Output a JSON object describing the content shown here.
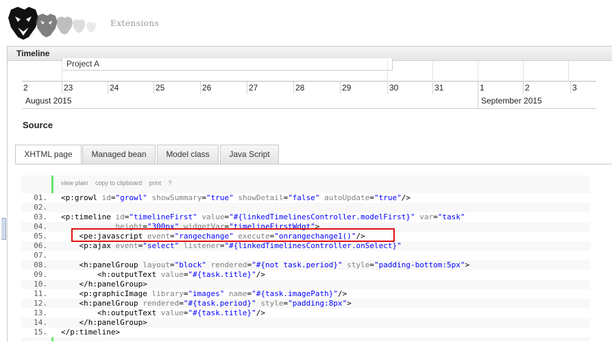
{
  "header": {
    "extensions_label": "Extensions"
  },
  "panel": {
    "title": "Timeline"
  },
  "timeline": {
    "event_label": "Project A",
    "days": [
      "2",
      "23",
      "24",
      "25",
      "26",
      "27",
      "28",
      "29",
      "30",
      "31",
      "1",
      "2",
      "3"
    ],
    "months": [
      "August 2015",
      "September 2015"
    ]
  },
  "source": {
    "title": "Source",
    "tabs": [
      "XHTML page",
      "Managed bean",
      "Model class",
      "Java Script"
    ]
  },
  "code": {
    "toolbar": [
      "view plain",
      "copy to clipboard",
      "print",
      "?"
    ],
    "lines": [
      {
        "n": "01.",
        "text": "<p:growl id=\"growl\" showSummary=\"true\" showDetail=\"false\" autoUpdate=\"true\"/>"
      },
      {
        "n": "02.",
        "text": ""
      },
      {
        "n": "03.",
        "text": "<p:timeline id=\"timelineFirst\" value=\"#{linkedTimelinesController.modelFirst}\" var=\"task\""
      },
      {
        "n": "04.",
        "text": "            height=\"300px\" widgetVar=\"timelineFirstWdgt\">"
      },
      {
        "n": "05.",
        "text": "    <pe:javascript event=\"rangechange\" execute=\"onrangechange1()\"/>"
      },
      {
        "n": "06.",
        "text": "    <p:ajax event=\"select\" listener=\"#{linkedTimelinesController.onSelect}\""
      },
      {
        "n": "07.",
        "text": ""
      },
      {
        "n": "08.",
        "text": "    <h:panelGroup layout=\"block\" rendered=\"#{not task.period}\" style=\"padding-bottom:5px\">"
      },
      {
        "n": "09.",
        "text": "        <h:outputText value=\"#{task.title}\"/>"
      },
      {
        "n": "10.",
        "text": "    </h:panelGroup>"
      },
      {
        "n": "11.",
        "text": "    <p:graphicImage library=\"images\" name=\"#{task.imagePath}\"/>"
      },
      {
        "n": "12.",
        "text": "    <h:panelGroup rendered=\"#{task.period}\" style=\"padding:8px\">"
      },
      {
        "n": "13.",
        "text": "        <h:outputText value=\"#{task.title}\"/>"
      },
      {
        "n": "14.",
        "text": "    </h:panelGroup>"
      },
      {
        "n": "15.",
        "text": "</p:timeline>"
      }
    ]
  },
  "colors": {
    "highlight_box": "#e01010",
    "gutter_accent": "#6ce26c",
    "attr": "#808080",
    "value": "#0000ff"
  }
}
